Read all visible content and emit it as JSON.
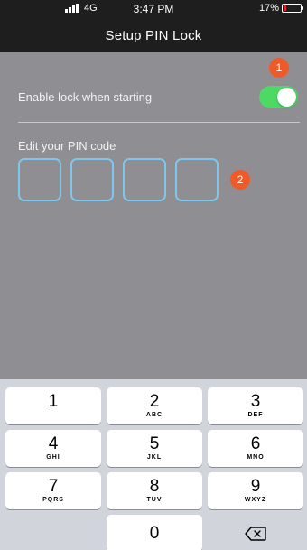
{
  "status_bar": {
    "network": "4G",
    "time": "3:47 PM",
    "battery_text": "17%",
    "battery_level": 0.17,
    "battery_color": "#e0242a"
  },
  "nav": {
    "title": "Setup PIN Lock"
  },
  "settings": {
    "enable_lock_label": "Enable lock when starting",
    "enable_lock_on": true,
    "toggle_color": "#4cd964",
    "pin_label": "Edit your PIN code",
    "pin_length": 4
  },
  "badges": {
    "badge_1": "1",
    "badge_2": "2",
    "color": "#f05a28"
  },
  "keypad": {
    "keys": [
      {
        "digit": "1",
        "letters": ""
      },
      {
        "digit": "2",
        "letters": "ABC"
      },
      {
        "digit": "3",
        "letters": "DEF"
      },
      {
        "digit": "4",
        "letters": "GHI"
      },
      {
        "digit": "5",
        "letters": "JKL"
      },
      {
        "digit": "6",
        "letters": "MNO"
      },
      {
        "digit": "7",
        "letters": "PQRS"
      },
      {
        "digit": "8",
        "letters": "TUV"
      },
      {
        "digit": "9",
        "letters": "WXYZ"
      },
      {
        "digit": "0",
        "letters": ""
      }
    ],
    "delete_icon": "backspace-icon"
  }
}
